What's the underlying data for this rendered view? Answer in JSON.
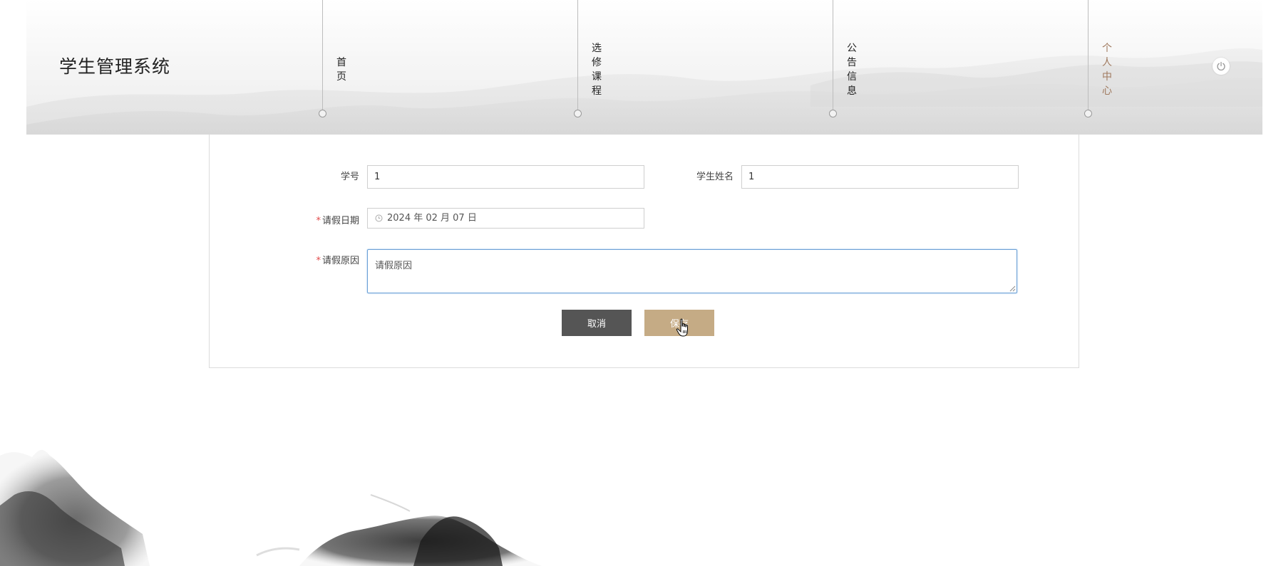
{
  "app": {
    "title": "学生管理系统"
  },
  "nav": {
    "items": [
      {
        "label": "首页",
        "active": false
      },
      {
        "label": "选修课程",
        "active": false
      },
      {
        "label": "公告信息",
        "active": false
      },
      {
        "label": "个人中心",
        "active": true
      }
    ],
    "power_icon": "power-icon"
  },
  "form": {
    "student_id": {
      "label": "学号",
      "value": "1"
    },
    "student_name": {
      "label": "学生姓名",
      "value": "1"
    },
    "leave_date": {
      "label": "请假日期",
      "required_mark": "*",
      "value": "2024 年 02 月 07 日",
      "icon": "clock-icon"
    },
    "leave_reason": {
      "label": "请假原因",
      "required_mark": "*",
      "placeholder": "请假原因"
    },
    "buttons": {
      "cancel": "取消",
      "save": "保存"
    }
  },
  "colors": {
    "accent_save": "#c5ab85",
    "cancel": "#555555",
    "active_nav": "#a07a5f",
    "required": "#e24b4b",
    "focus_border": "#6aa0d6"
  }
}
